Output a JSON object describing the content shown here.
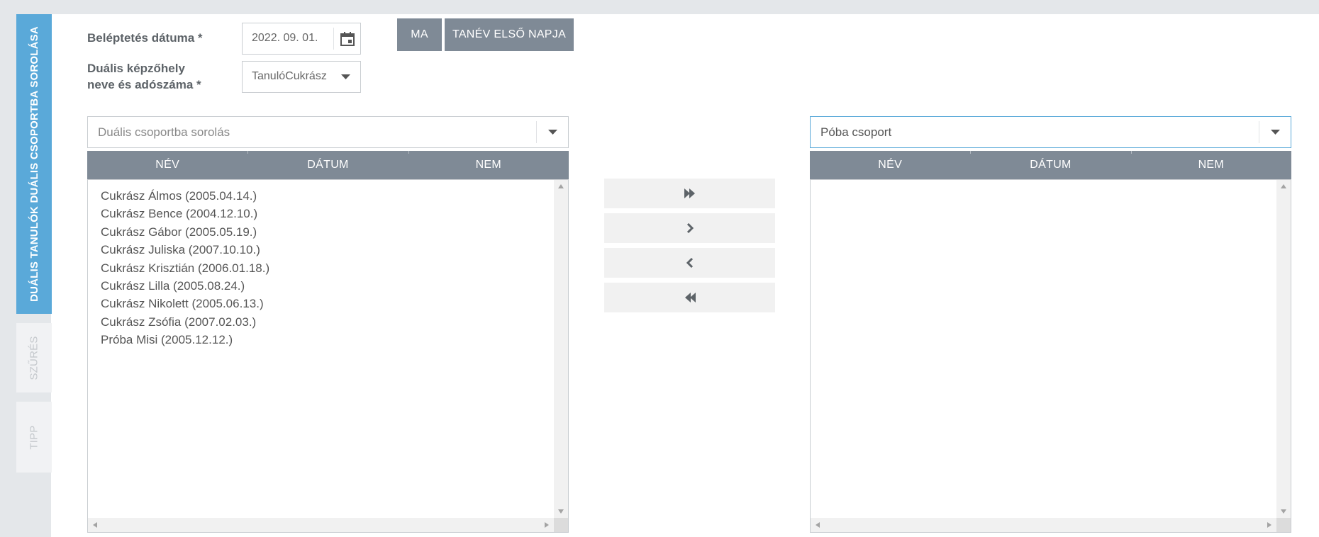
{
  "side_tabs": {
    "active": "DUÁLIS TANULÓK DUÁLIS CSOPORTBA SOROLÁSA",
    "filter": "SZŰRÉS",
    "tip": "TIPP"
  },
  "form": {
    "entry_date_label": "Beléptetés dátuma *",
    "entry_date_value": "2022. 09. 01.",
    "training_place_label_line1": "Duális képzőhely",
    "training_place_label_line2": "neve és adószáma *",
    "training_place_value": "TanulóCukrász",
    "today_button": "MA",
    "school_year_first_day_button": "TANÉV ELSŐ NAPJA"
  },
  "left_panel": {
    "combo_placeholder": "Duális csoportba sorolás",
    "columns": [
      "NÉV",
      "DÁTUM",
      "NEM"
    ],
    "items": [
      "Cukrász Álmos (2005.04.14.)",
      "Cukrász Bence (2004.12.10.)",
      "Cukrász Gábor (2005.05.19.)",
      "Cukrász Juliska (2007.10.10.)",
      "Cukrász Krisztián (2006.01.18.)",
      "Cukrász Lilla (2005.08.24.)",
      "Cukrász Nikolett (2005.06.13.)",
      "Cukrász Zsófia (2007.02.03.)",
      "Próba Misi (2005.12.12.)"
    ]
  },
  "right_panel": {
    "combo_value": "Póba csoport",
    "columns": [
      "NÉV",
      "DÁTUM",
      "NEM"
    ],
    "items": []
  },
  "move_buttons": {
    "move_all_right_icon": "double-chevron-right-icon",
    "move_right_icon": "chevron-right-icon",
    "move_left_icon": "chevron-left-icon",
    "move_all_left_icon": "double-chevron-left-icon"
  },
  "colors": {
    "accent": "#5aa9d9",
    "header_bg": "#7f8a96",
    "button_bg": "#7f8a96",
    "move_button_bg": "#f1f1f1"
  }
}
